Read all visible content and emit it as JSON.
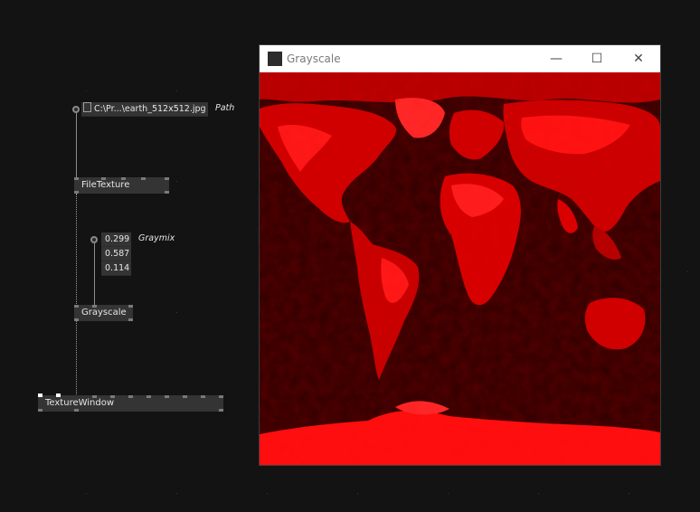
{
  "nodes": {
    "path_iobox": {
      "value": "C:\\Pr...\\earth_512x512.jpg",
      "pin_label": "Path"
    },
    "file_texture": {
      "label": "FileTexture"
    },
    "graymix_iobox": {
      "values": [
        "0.299",
        "0.587",
        "0.114"
      ],
      "pin_label": "Graymix"
    },
    "grayscale": {
      "label": "Grayscale"
    },
    "texture_window": {
      "label": "TextureWindow"
    }
  },
  "window": {
    "title": "Grayscale",
    "minimize_glyph": "—",
    "maximize_glyph": "☐",
    "close_glyph": "✕",
    "content": "earth texture tinted red",
    "tint_color": "#ff0000"
  }
}
